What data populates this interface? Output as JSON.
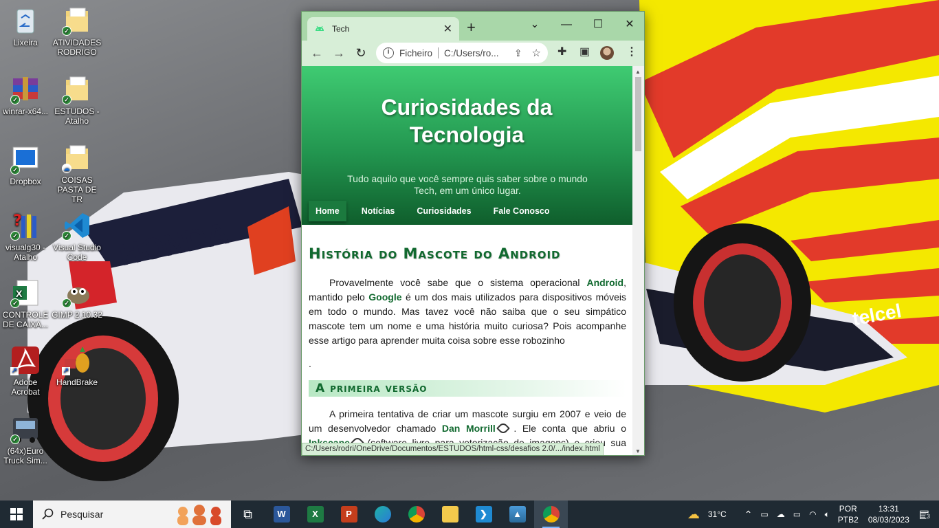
{
  "desktop": {
    "icons": [
      {
        "label": "Lixeira"
      },
      {
        "label": "ATIVIDADES RODRIGO"
      },
      {
        "label": "winrar-x64..."
      },
      {
        "label": "ESTUDOS - Atalho"
      },
      {
        "label": "Dropbox"
      },
      {
        "label": "COISAS PASTA DE TR"
      },
      {
        "label": "visualg30 - Atalho"
      },
      {
        "label": "Visual Studio Code"
      },
      {
        "label": "CONTROLE DE CAIXA..."
      },
      {
        "label": "GIMP 2.10.32"
      },
      {
        "label": "Adobe Acrobat"
      },
      {
        "label": "HandBrake"
      },
      {
        "label": "(64x)Euro Truck Sim..."
      }
    ]
  },
  "browser": {
    "tab_title": "Tech",
    "tab_close": "✕",
    "new_tab": "+",
    "window_controls": {
      "dropdown": "⌄",
      "minimize": "—",
      "maximize": "☐",
      "close": "✕"
    },
    "nav": {
      "back": "←",
      "forward": "→",
      "reload": "↻"
    },
    "address": {
      "scheme_label": "Ficheiro",
      "url": "C:/Users/ro..."
    },
    "status_url": "C:/Users/rodri/OneDrive/Documentos/ESTUDOS/html-css/desafios 2.0/.../index.html"
  },
  "page": {
    "title": "Curiosidades da Tecnologia",
    "subtitle": "Tudo aquilo que você sempre quis saber sobre o mundo Tech, em um único lugar.",
    "menu": [
      {
        "label": "Home",
        "active": true
      },
      {
        "label": "Notícias",
        "active": false
      },
      {
        "label": "Curiosidades",
        "active": false
      },
      {
        "label": "Fale Conosco",
        "active": false
      }
    ],
    "article": {
      "heading": "História do Mascote do Android",
      "p1": {
        "t1": "Provavelmente você sabe que o sistema operacional ",
        "k1": "Android",
        "t2": ", mantido pelo ",
        "k2": "Google",
        "t3": " é um dos mais utilizados para dispositivos móveis em todo o mundo. Mas tavez você não saiba que o seu simpático mascote tem um nome e uma história muito curiosa? Pois acompanhe esse artigo para aprender muita coisa sobre esse robozinho"
      },
      "dot": ".",
      "subheading": "A primeira versão",
      "p2": {
        "t1": "A primeira tentativa de criar um mascote surgiu em 2007 e veio de um desenvolvedor chamado ",
        "k1": "Dan Morrill",
        "t2": " . Ele conta que abriu o ",
        "k2": "Inkscape",
        "t3": " (software livre para vetorização de imagens) e criou sua primeira versão do mascote, que não era muito parecida com a que conhecemos hoje"
      }
    }
  },
  "taskbar": {
    "search_placeholder": "Pesquisar",
    "apps": [
      "task-view",
      "word",
      "excel",
      "powerpoint",
      "edge",
      "chrome",
      "file-explorer",
      "vscode",
      "photos",
      "chrome-dev"
    ],
    "weather": "31°C",
    "language": {
      "line1": "POR",
      "line2": "PTB2"
    },
    "time": "13:31",
    "date": "08/03/2023",
    "notifications": "3"
  },
  "colors": {
    "accent_green": "#11692f",
    "header_green": "#22954f",
    "chrome_frame": "#a9d7a9",
    "taskbar": "#1f2a33"
  }
}
